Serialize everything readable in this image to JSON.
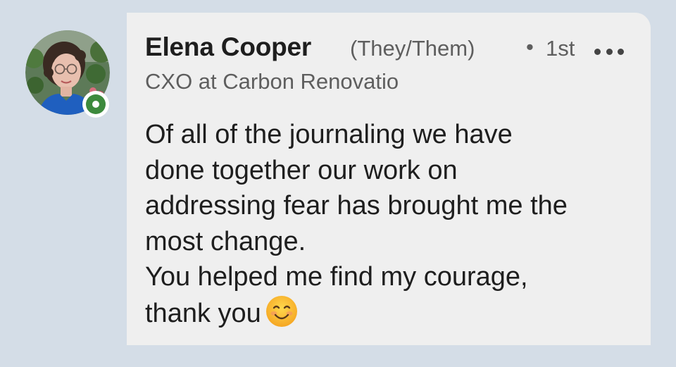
{
  "comment": {
    "author": {
      "name": "Elena Cooper",
      "pronouns": "(They/Them)",
      "separator": "•",
      "degree": "1st",
      "headline": "CXO at Carbon Renovatio",
      "online": true
    },
    "text_lines": [
      "Of all of the journaling we have",
      "done together our work on",
      "addressing fear has brought me the",
      "most change.",
      "You helped me find my courage,",
      "thank you"
    ],
    "emoji": "smiling-face-icon"
  },
  "colors": {
    "background": "#d4dde7",
    "bubble": "#efefef",
    "presence_green": "#3d8a3d",
    "text_primary": "#1e1e1e",
    "text_secondary": "#5e5e5e"
  }
}
